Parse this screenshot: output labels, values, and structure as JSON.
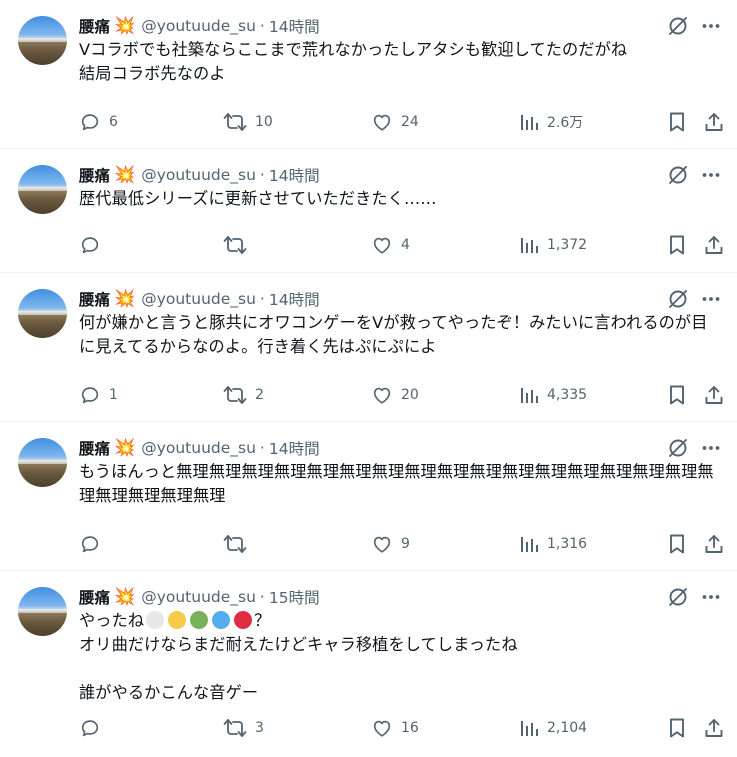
{
  "tweets": [
    {
      "name": "腰痛",
      "handle": "@youtuude_su",
      "time": "14時間",
      "text": "Vコラボでも社築ならここまで荒れなかったしアタシも歓迎してたのだがね\n結局コラボ先なのよ",
      "replies": "6",
      "retweets": "10",
      "likes": "24",
      "views": "2.6万"
    },
    {
      "name": "腰痛",
      "handle": "@youtuude_su",
      "time": "14時間",
      "text": "歴代最低シリーズに更新させていただきたく……",
      "replies": "",
      "retweets": "",
      "likes": "4",
      "views": "1,372"
    },
    {
      "name": "腰痛",
      "handle": "@youtuude_su",
      "time": "14時間",
      "text": "何が嫌かと言うと豚共にオワコンゲーをVが救ってやったぞ！みたいに言われるのが目に見えてるからなのよ。行き着く先はぷにぷによ",
      "replies": "1",
      "retweets": "2",
      "likes": "20",
      "views": "4,335"
    },
    {
      "name": "腰痛",
      "handle": "@youtuude_su",
      "time": "14時間",
      "text": "もうほんっと無理無理無理無理無理無理無理無理無理無理無理無理無理無理無理無理無理無理無理無理無理",
      "replies": "",
      "retweets": "",
      "likes": "9",
      "views": "1,316"
    },
    {
      "name": "腰痛",
      "handle": "@youtuude_su",
      "time": "15時間",
      "text_line1_prefix": "やったね",
      "text_line1_suffix": "？",
      "dot_colors": [
        "#e6e7e8",
        "#f7c948",
        "#78b159",
        "#55acee",
        "#dd2e44"
      ],
      "text_rest": "オリ曲だけならまだ耐えたけどキャラ移植をしてしまったね\n\n誰がやるかこんな音ゲー",
      "replies": "",
      "retweets": "3",
      "likes": "16",
      "views": "2,104"
    }
  ],
  "icons": {
    "name_badge": "collision-emoji",
    "grok": "grok-icon",
    "more": "more-icon",
    "reply": "reply-icon",
    "retweet": "retweet-icon",
    "like": "heart-icon",
    "views": "views-icon",
    "bookmark": "bookmark-icon",
    "share": "share-icon"
  },
  "colors": {
    "secondary_text": "#536471",
    "primary_text": "#0f1419",
    "divider": "#eff3f4"
  }
}
